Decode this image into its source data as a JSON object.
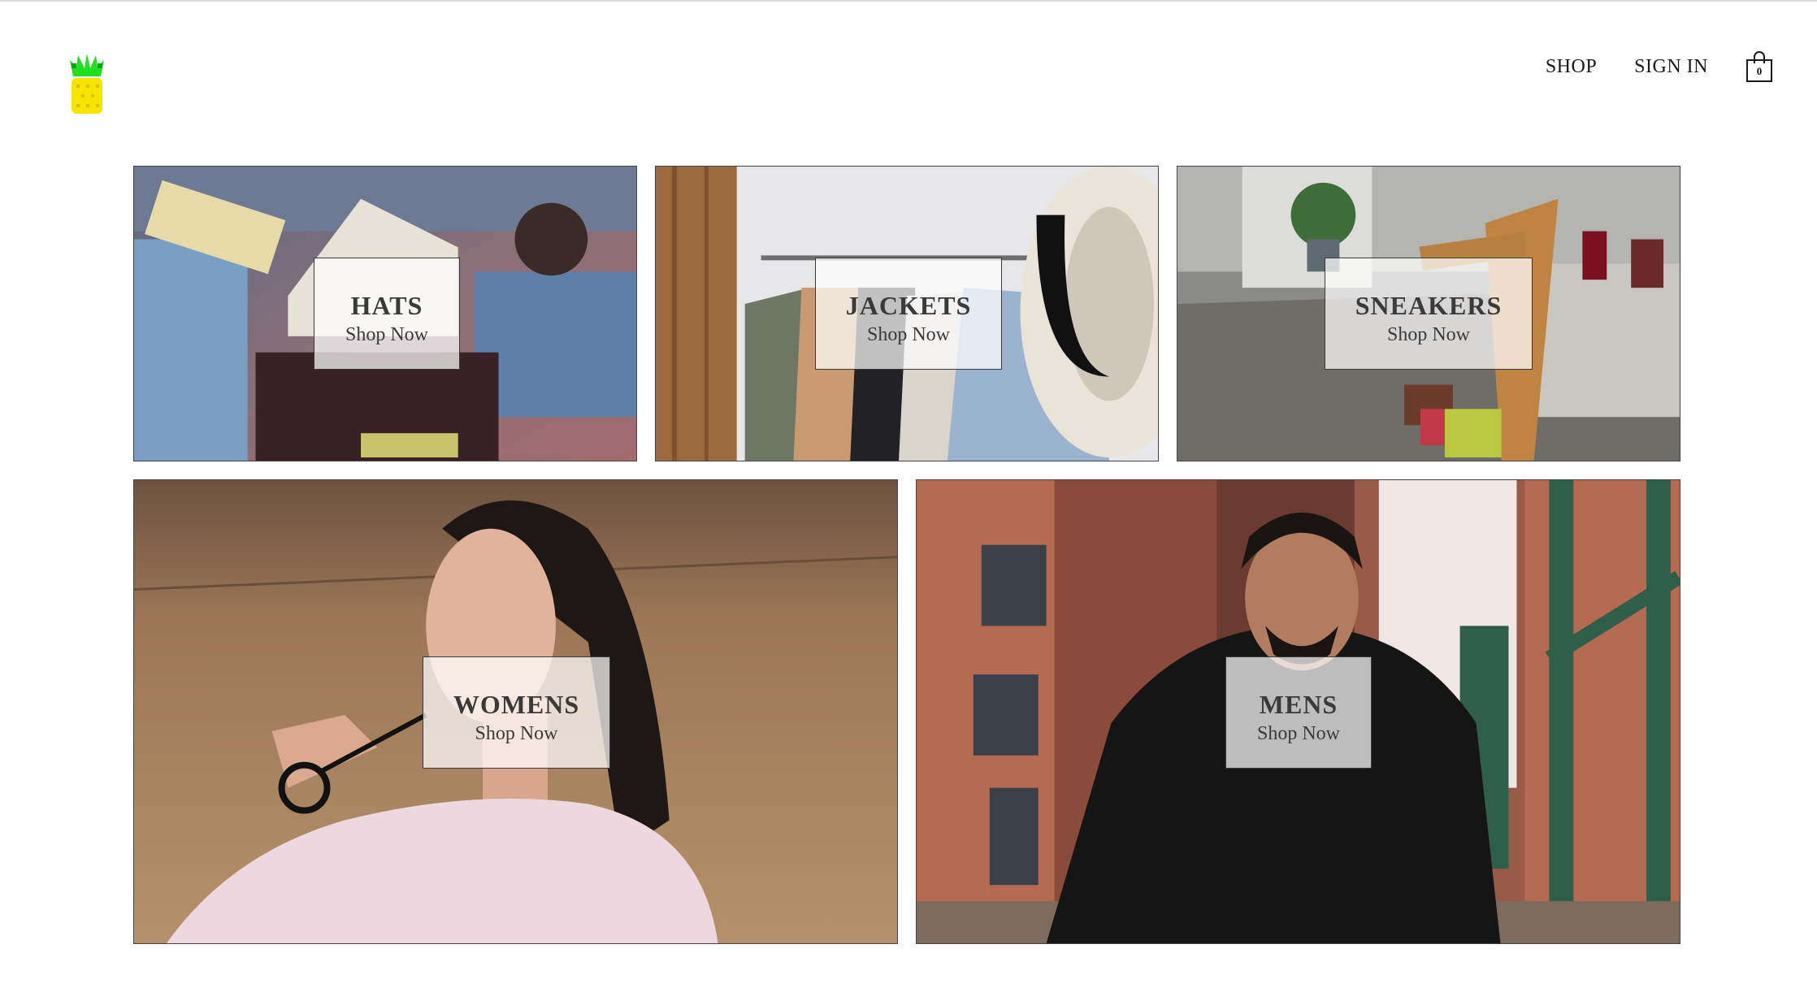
{
  "header": {
    "nav": {
      "shop_label": "SHOP",
      "signin_label": "SIGN IN"
    },
    "cart": {
      "count": "0",
      "icon": "shopping-bag-icon"
    },
    "logo": {
      "icon": "pineapple-logo-icon",
      "colors": {
        "leaves": "#22dd22",
        "fruit": "#f7e400"
      }
    }
  },
  "categories": [
    {
      "title": "HATS",
      "subtitle": "Shop Now"
    },
    {
      "title": "JACKETS",
      "subtitle": "Shop Now"
    },
    {
      "title": "SNEAKERS",
      "subtitle": "Shop Now"
    },
    {
      "title": "WOMENS",
      "subtitle": "Shop Now"
    },
    {
      "title": "MENS",
      "subtitle": "Shop Now"
    }
  ]
}
